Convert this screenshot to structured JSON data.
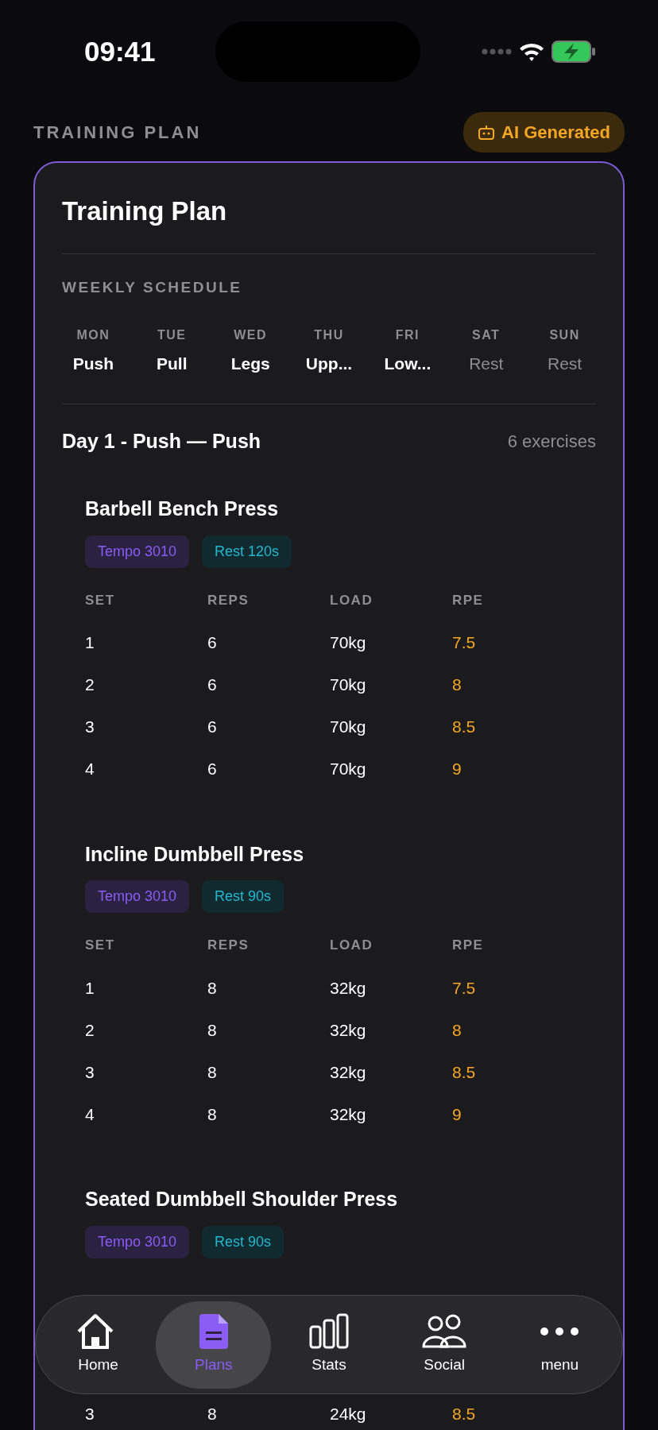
{
  "status_bar": {
    "time": "09:41"
  },
  "header": {
    "title": "TRAINING PLAN",
    "badge": "AI Generated"
  },
  "card": {
    "title": "Training Plan",
    "schedule_label": "WEEKLY SCHEDULE",
    "days": [
      {
        "day": "MON",
        "workout": "Push",
        "rest": false
      },
      {
        "day": "TUE",
        "workout": "Pull",
        "rest": false
      },
      {
        "day": "WED",
        "workout": "Legs",
        "rest": false
      },
      {
        "day": "THU",
        "workout": "Upp...",
        "rest": false
      },
      {
        "day": "FRI",
        "workout": "Low...",
        "rest": false
      },
      {
        "day": "SAT",
        "workout": "Rest",
        "rest": true
      },
      {
        "day": "SUN",
        "workout": "Rest",
        "rest": true
      }
    ],
    "day_title": "Day 1 - Push — Push",
    "exercise_count": "6 exercises",
    "exercises": [
      {
        "name": "Barbell Bench Press",
        "tempo": "Tempo 3010",
        "rest": "Rest 120s",
        "columns": [
          "SET",
          "REPS",
          "LOAD",
          "RPE"
        ],
        "rows": [
          [
            "1",
            "6",
            "70kg",
            "7.5"
          ],
          [
            "2",
            "6",
            "70kg",
            "8"
          ],
          [
            "3",
            "6",
            "70kg",
            "8.5"
          ],
          [
            "4",
            "6",
            "70kg",
            "9"
          ]
        ]
      },
      {
        "name": "Incline Dumbbell Press",
        "tempo": "Tempo 3010",
        "rest": "Rest 90s",
        "columns": [
          "SET",
          "REPS",
          "LOAD",
          "RPE"
        ],
        "rows": [
          [
            "1",
            "8",
            "32kg",
            "7.5"
          ],
          [
            "2",
            "8",
            "32kg",
            "8"
          ],
          [
            "3",
            "8",
            "32kg",
            "8.5"
          ],
          [
            "4",
            "8",
            "32kg",
            "9"
          ]
        ]
      },
      {
        "name": "Seated Dumbbell Shoulder Press",
        "tempo": "Tempo 3010",
        "rest": "Rest 90s",
        "rows": [
          [
            "3",
            "8",
            "24kg",
            "8.5"
          ]
        ]
      }
    ]
  },
  "tab_bar": [
    {
      "label": "Home",
      "selected": false
    },
    {
      "label": "Plans",
      "selected": true
    },
    {
      "label": "Stats",
      "selected": false
    },
    {
      "label": "Social",
      "selected": false
    },
    {
      "label": "menu",
      "selected": false
    }
  ]
}
